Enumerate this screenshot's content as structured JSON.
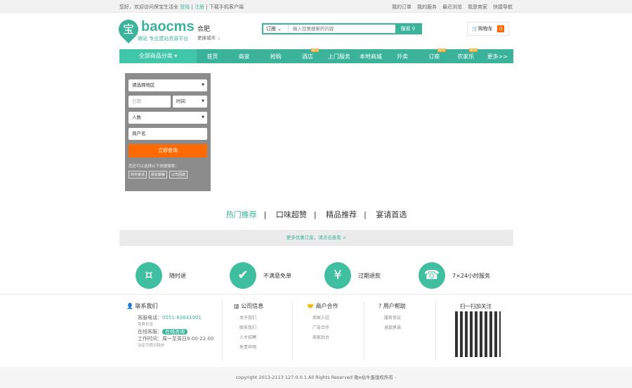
{
  "topbar": {
    "welcome": "您好，欢迎访问保宝生活全",
    "login": "登陆",
    "register": "注册",
    "app": "下载手机客户端",
    "links": [
      "我的订单",
      "我的服务",
      "最近浏览",
      "我是商家",
      "快捷导航"
    ]
  },
  "header": {
    "logo_char": "宝",
    "brand": "baocms",
    "slogan": "微站 专业建站资源平台",
    "city": "合肥",
    "change_city": "更换城市",
    "search_select": "订座",
    "search_placeholder": "输入您要搜索的内容",
    "search_button": "搜索",
    "cart_label": "购物车",
    "cart_count": "0"
  },
  "nav": {
    "all": "全部商品分类",
    "items": [
      {
        "label": "首页",
        "new": ""
      },
      {
        "label": "商家",
        "new": ""
      },
      {
        "label": "抢购",
        "new": ""
      },
      {
        "label": "酒店",
        "new": "NEW"
      },
      {
        "label": "上门服务",
        "new": ""
      },
      {
        "label": "本地商城",
        "new": ""
      },
      {
        "label": "外卖",
        "new": ""
      },
      {
        "label": "订座",
        "new": "NEW"
      },
      {
        "label": "农家乐",
        "new": "NEW"
      },
      {
        "label": "更多>>",
        "new": ""
      }
    ]
  },
  "form": {
    "region": "请选择地区",
    "date": "日期",
    "time": "时间",
    "people": "人数",
    "name": "商户名",
    "submit": "立即查询",
    "hint": "您还可以选择以下快捷搜索：",
    "tags": [
      "商务宴请",
      "朋友聚餐",
      "公司团建"
    ]
  },
  "tabs": [
    "热门推荐",
    "口味超赞",
    "精品推荐",
    "宴请首选"
  ],
  "more": "更多优惠订座，请点击查看 >",
  "features": [
    {
      "icon": "¤",
      "label": "随时退"
    },
    {
      "icon": "✔",
      "label": "不满意免单"
    },
    {
      "icon": "¥",
      "label": "过期退款"
    },
    {
      "icon": "☎",
      "label": "7×24小时服务"
    }
  ],
  "footer": {
    "contact": {
      "title": "联系我们",
      "phone_label": "客服电话：",
      "phone": "0551-63641901",
      "phone_note": "免费长途",
      "online_label": "在线客服：",
      "online_btn": "在线咨询",
      "hours": "工作时间：周一至周日9:00-22:00",
      "hours_note": "法定节假日除外"
    },
    "company": {
      "title": "公司信息",
      "items": [
        "关于我们",
        "联系我们",
        "人才招聘",
        "免责声明"
      ]
    },
    "partner": {
      "title": "商户合作",
      "items": [
        "商家入驻",
        "广告合作",
        "商家后台"
      ]
    },
    "help": {
      "title": "用户帮助",
      "items": [
        "服务协议",
        "退款承诺"
      ]
    },
    "qr_title": "扫一扫加关注",
    "copyright": "copyright 2013-2113 127.0.0.1 All Rights Reserved 微e站牛蛋版权所有 -"
  }
}
